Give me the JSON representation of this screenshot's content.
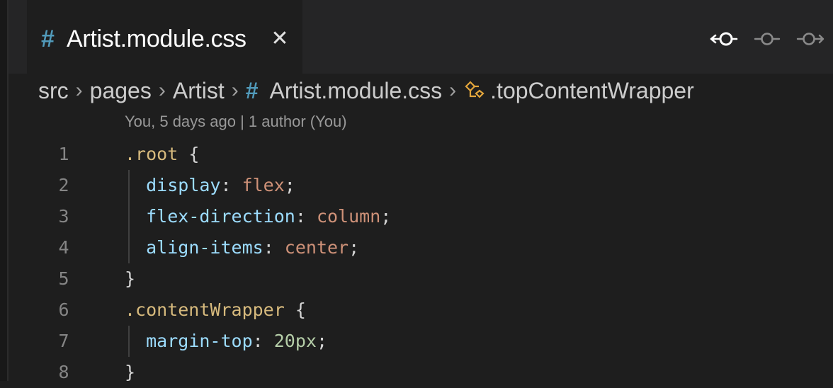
{
  "tab": {
    "icon": "#",
    "label": "Artist.module.css",
    "close": "✕"
  },
  "toolbar": {
    "icons": [
      "go-back-icon",
      "go-step-icon",
      "go-forward-icon"
    ]
  },
  "breadcrumb": {
    "items": [
      "src",
      "pages",
      "Artist"
    ],
    "file_icon": "#",
    "file": "Artist.module.css",
    "symbol": ".topContentWrapper",
    "separator": "›"
  },
  "codelens": "You, 5 days ago | 1 author (You)",
  "code": {
    "lines": [
      {
        "num": "1",
        "selector": ".root",
        "open": " {"
      },
      {
        "num": "2",
        "prop": "display",
        "colon": ": ",
        "value": "flex",
        "semi": ";"
      },
      {
        "num": "3",
        "prop": "flex-direction",
        "colon": ": ",
        "value": "column",
        "semi": ";"
      },
      {
        "num": "4",
        "prop": "align-items",
        "colon": ": ",
        "value": "center",
        "semi": ";"
      },
      {
        "num": "5",
        "close": "}"
      },
      {
        "num": "6",
        "selector": ".contentWrapper",
        "open": " {"
      },
      {
        "num": "7",
        "prop": "margin-top",
        "colon": ": ",
        "number": "20px",
        "semi": ";"
      },
      {
        "num": "8",
        "close": "}"
      }
    ]
  },
  "colors": {
    "background": "#1e1e1e",
    "selector": "#d7ba7d",
    "property": "#9cdcfe",
    "value": "#ce9178",
    "number": "#b5cea8",
    "css_icon": "#519aba",
    "symbol_icon": "#e2a53c"
  }
}
